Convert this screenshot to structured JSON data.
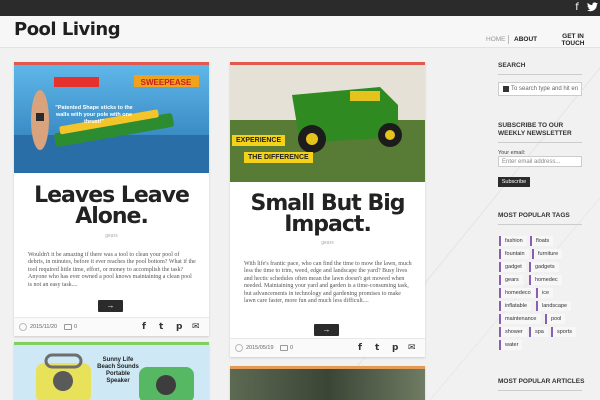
{
  "site": {
    "logo": "Pool Living"
  },
  "topbar": {
    "social": [
      "facebook-icon",
      "twitter-icon"
    ],
    "facebook_glyph": "f",
    "twitter_glyph": "🐦"
  },
  "nav": {
    "home": "HOME",
    "about": "ABOUT",
    "getin": "GET IN TOUCH"
  },
  "posts": [
    {
      "title": "Leaves Leave Alone.",
      "tag": "gears",
      "excerpt": "Wouldn't it be amazing if there was a tool to clean your pool of debris, in minutes, before it ever reaches the pool bottom? What if the tool required little time, effort, or money to accomplish the task? Anyone who has ever owned a pool knows maintaining a clean pool is not an easy task....",
      "date": "2015/11/20",
      "comments": "0",
      "accent": "#e2584e",
      "image_caption_top": "SWEEPEASE",
      "image_caption": "\"Patented Shape sticks to the walls with your pole with one thrust!\""
    },
    {
      "title": "Small But Big Impact.",
      "tag": "gears",
      "excerpt": "With life's frantic pace, who can find the time to mow the lawn, much less the time to trim, weed, edge and landscape the yard? Busy lives and hectic schedules often mean the lawn doesn't get mowed when needed. Maintaining your yard and garden is a time-consuming task, but advancements in technology and gardening promises to make lawn care faster, more fun and much less difficult....",
      "date": "2015/05/19",
      "comments": "0",
      "accent": "#e2584e",
      "image_badge_1": "EXPERIENCE",
      "image_badge_2": "THE DIFFERENCE"
    },
    {
      "accent": "#7fcf63",
      "image_caption": "Sunny Life Beach Sounds Portable Speaker"
    },
    {
      "accent": "#e39a55"
    }
  ],
  "more_glyph": "→",
  "share": {
    "facebook": "f",
    "twitter": "t",
    "pinterest": "p",
    "email": "✉"
  },
  "sidebar": {
    "search_title": "SEARCH",
    "search_placeholder": "To search type and hit en",
    "newsletter_title": "SUBSCRIBE TO OUR WEEKLY NEWSLETTER",
    "email_label": "Your email:",
    "email_placeholder": "Enter email address...",
    "subscribe": "Subscribe",
    "tags_title": "MOST POPULAR TAGS",
    "tags": [
      "fashion",
      "floats",
      "fountain",
      "furniture",
      "gadget",
      "gadgets",
      "gears",
      "homedec",
      "homedeco",
      "ice",
      "inflatable",
      "landscape",
      "maintenance",
      "pool",
      "shower",
      "spa",
      "sports",
      "water"
    ],
    "articles_title": "MOST POPULAR ARTICLES"
  },
  "colors": {
    "accent_red": "#e2584e",
    "tag_purple": "#8a5fb3",
    "dark": "#2b2b2b"
  }
}
